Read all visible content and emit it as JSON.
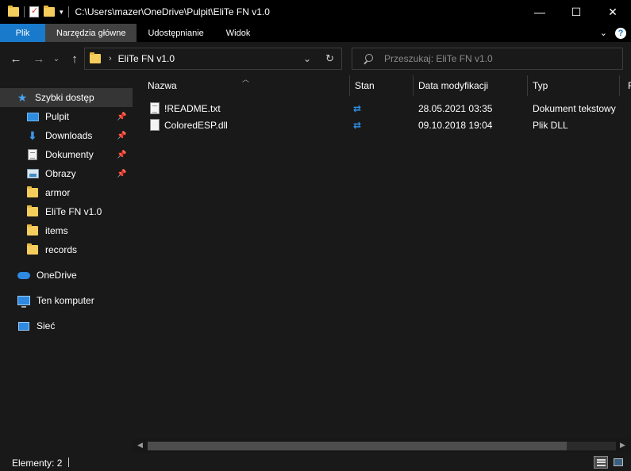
{
  "window": {
    "title": "C:\\Users\\mazer\\OneDrive\\Pulpit\\EliTe FN v1.0",
    "controls": {
      "minimize": "—",
      "maximize": "☐",
      "close": "✕"
    }
  },
  "ribbon": {
    "tabs": [
      {
        "label": "Plik"
      },
      {
        "label": "Narzędzia główne"
      },
      {
        "label": "Udostępnianie"
      },
      {
        "label": "Widok"
      }
    ]
  },
  "nav": {
    "address_folder": "EliTe FN v1.0",
    "search_placeholder": "Przeszukaj: EliTe FN v1.0"
  },
  "sidebar": {
    "items": [
      {
        "label": "Szybki dostęp",
        "icon": "star-icon"
      },
      {
        "label": "Pulpit",
        "icon": "desktop-icon",
        "pinned": true
      },
      {
        "label": "Downloads",
        "icon": "download-icon",
        "pinned": true
      },
      {
        "label": "Dokumenty",
        "icon": "documents-icon",
        "pinned": true
      },
      {
        "label": "Obrazy",
        "icon": "pictures-icon",
        "pinned": true
      },
      {
        "label": "armor",
        "icon": "folder-icon"
      },
      {
        "label": "EliTe FN v1.0",
        "icon": "folder-icon"
      },
      {
        "label": "items",
        "icon": "folder-icon"
      },
      {
        "label": "records",
        "icon": "folder-icon"
      },
      {
        "label": "OneDrive",
        "icon": "onedrive-icon"
      },
      {
        "label": "Ten komputer",
        "icon": "computer-icon"
      },
      {
        "label": "Sieć",
        "icon": "network-icon"
      }
    ]
  },
  "files": {
    "columns": [
      "Nazwa",
      "Stan",
      "Data modyfikacji",
      "Typ",
      "R"
    ],
    "rows": [
      {
        "name": "!README.txt",
        "date": "28.05.2021 03:35",
        "type": "Dokument tekstowy"
      },
      {
        "name": "ColoredESP.dll",
        "date": "09.10.2018 19:04",
        "type": "Plik DLL"
      }
    ]
  },
  "status": {
    "items_text": "Elementy: 2"
  },
  "colors": {
    "file_tab": "#1979ca",
    "background": "#191919",
    "titlebar": "#000000",
    "accent_sync": "#2f8fe6"
  }
}
